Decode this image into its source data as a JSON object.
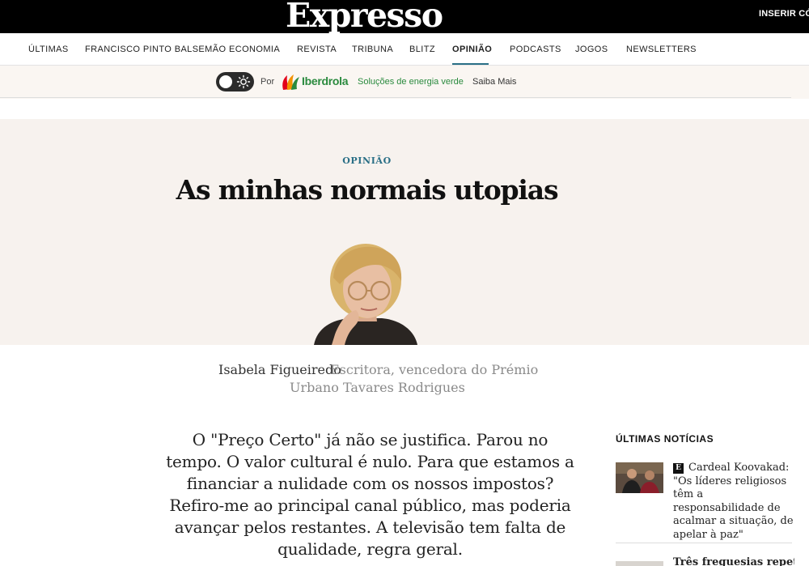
{
  "header": {
    "logo": "Expresso",
    "login_label": "INSERIR CÓDIGO"
  },
  "nav": {
    "items": [
      {
        "label": "ÚLTIMAS",
        "active": false
      },
      {
        "label": "FRANCISCO PINTO BALSEMÃO",
        "active": false
      },
      {
        "label": "ECONOMIA",
        "active": false
      },
      {
        "label": "REVISTA",
        "active": false
      },
      {
        "label": "TRIBUNA",
        "active": false
      },
      {
        "label": "BLITZ",
        "active": false
      },
      {
        "label": "OPINIÃO",
        "active": true
      },
      {
        "label": "PODCASTS",
        "active": false
      },
      {
        "label": "JOGOS",
        "active": false
      },
      {
        "label": "NEWSLETTERS",
        "active": false
      }
    ],
    "accent_color": "#2a6f86"
  },
  "sponsor": {
    "prefix": "Por",
    "brand": "Iberdrola",
    "tagline": "Soluções de energia verde",
    "cta": "Saiba Mais",
    "brand_color": "#2a8a3e"
  },
  "article": {
    "section": "OPINIÃO",
    "title": "As minhas normais utopias",
    "author": "Isabela Figueiredo",
    "author_role_line1": "Escritora, vencedora do Prémio",
    "author_role_line2": "Urbano Tavares Rodrigues",
    "body": "O \"Preço Certo\" já não se justifica. Parou no tempo. O valor cultural é nulo. Para que estamos a financiar a nulidade com os nossos impostos? Refiro-me ao principal canal público, mas poderia avançar pelos restantes. A televisão tem falta de qualidade, regra geral."
  },
  "sidebar": {
    "title": "ÚLTIMAS NOTÍCIAS",
    "items": [
      {
        "badge": "E",
        "text": "Cardeal Koovakad: \"Os líderes religiosos têm a responsabilidade de acalmar a situação, de apelar à paz\""
      },
      {
        "text": "Três freguesias repetem"
      }
    ]
  }
}
